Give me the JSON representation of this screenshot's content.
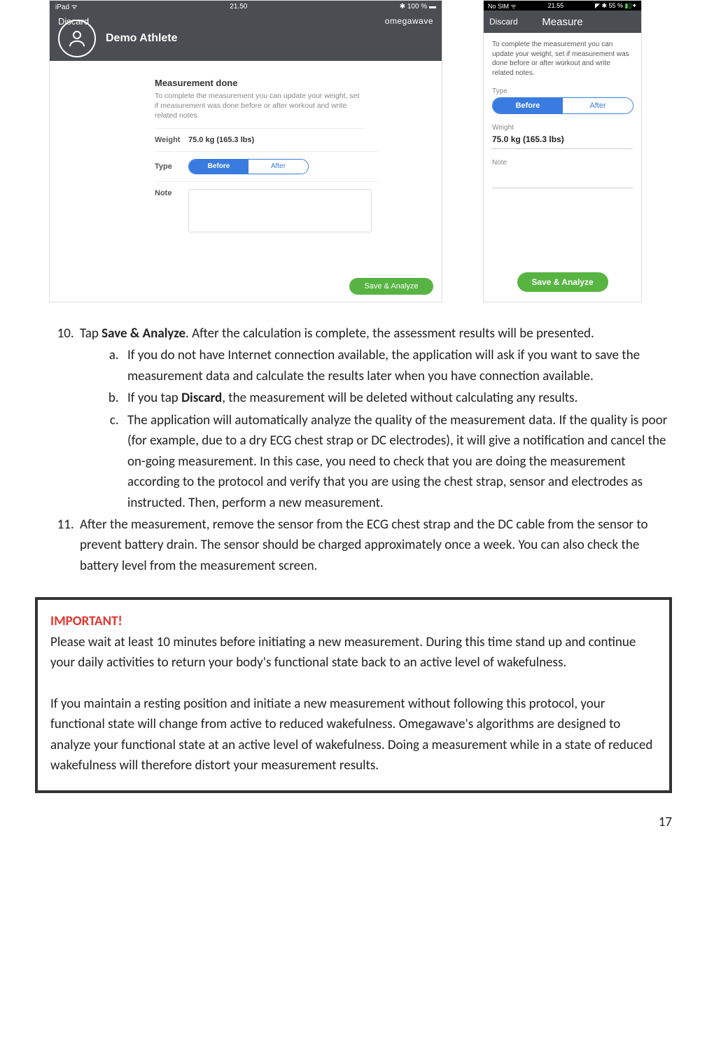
{
  "ipad": {
    "status_left": "iPad ᯤ",
    "status_center": "21.50",
    "status_right": "✱ 100 % ▬",
    "discard": "Discard",
    "brand": "omegawave",
    "athlete_name": "Demo Athlete",
    "heading": "Measurement done",
    "description": "To complete the measurement you can update your weight, set if measurement was done before or after workout and write related notes.",
    "weight_label": "Weight",
    "weight_value": "75.0 kg (165.3 lbs)",
    "type_label": "Type",
    "seg_before": "Before",
    "seg_after": "After",
    "note_label": "Note",
    "save_label": "Save & Analyze"
  },
  "phone": {
    "status_left": "No SIM ᯤ",
    "status_center": "21.55",
    "status_right_a": "◤ ✱ 55 %",
    "discard": "Discard",
    "title": "Measure",
    "description": "To complete the measurement you can update your weight, set if measurement was done before or after workout and write related notes.",
    "type_label": "Type",
    "seg_before": "Before",
    "seg_after": "After",
    "weight_label": "Weight",
    "weight_value": "75.0 kg (165.3 lbs)",
    "note_label": "Note",
    "save_label": "Save & Analyze"
  },
  "doc": {
    "item10_a": "Tap ",
    "item10_bold": "Save & Analyze",
    "item10_b": ". After the calculation is complete, the assessment results will be presented.",
    "sub_a": "If you do not have Internet connection available, the application will ask if you want to save the measurement data and calculate the results later when you have connection available.",
    "sub_b_1": "If you tap ",
    "sub_b_bold": "Discard",
    "sub_b_2": ", the measurement will be deleted without calculating any results.",
    "sub_c": "The application will automatically analyze the quality of the measurement data. If the quality is poor (for example, due to a dry ECG chest strap or DC electrodes), it will give a notification and cancel the on-going measurement. In this case, you need to check that you are doing the measurement according to the protocol and verify that you are using the chest strap, sensor and electrodes as instructed. Then, perform a new measurement.",
    "item11": "After the measurement, remove the sensor from the ECG chest strap and the DC cable from the sensor to prevent battery drain. The sensor should be charged approximately once a week. You can also check the battery level from the measurement screen."
  },
  "important": {
    "title": "IMPORTANT!",
    "p1": "Please wait at least 10 minutes before initiating a new measurement. During this time stand up and continue your daily activities to return your body's functional state back to an active level of wakefulness.",
    "p2": "If you maintain a resting position and initiate a new measurement without following this protocol, your functional state will change from active to reduced wakefulness. Omegawave's algorithms are designed to analyze your functional state at an active level of wakefulness. Doing a measurement while in a state of reduced wakefulness will therefore distort your measurement results."
  },
  "page_number": "17"
}
